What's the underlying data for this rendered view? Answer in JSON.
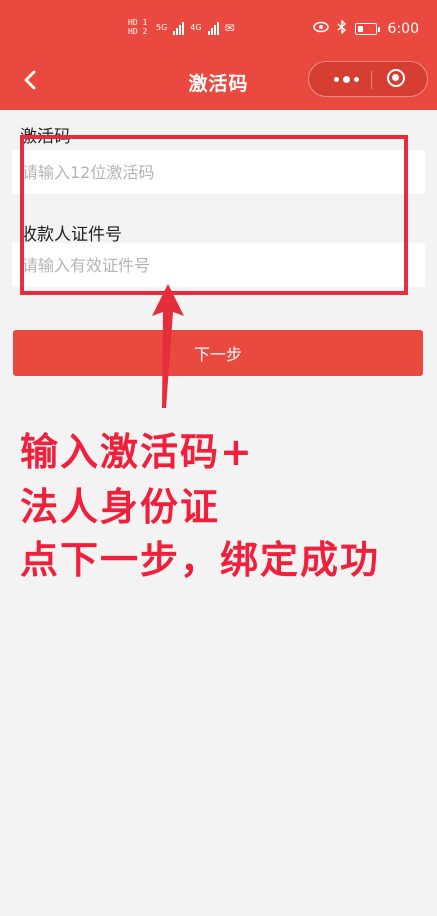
{
  "status_bar": {
    "sim1": "HD 1",
    "sim2": "HD 2",
    "net1": "5G",
    "net2": "4G",
    "time": "6:00"
  },
  "nav": {
    "title": "激活码",
    "icons": [
      "chevron-left-icon",
      "more-dots-icon",
      "close-circle-icon"
    ]
  },
  "form": {
    "activation_label": "激活码",
    "activation_placeholder": "请输入12位激活码",
    "id_label": "收款人证件号",
    "id_placeholder": "请输入有效证件号",
    "next_label": "下一步"
  },
  "annotation": {
    "line1": "输入激活码+",
    "line2": "法人身份证",
    "line3": "点下一步，绑定成功",
    "color": "#f0203c"
  },
  "colors": {
    "brand": "#e9493e",
    "highlight": "#e52d3b"
  }
}
